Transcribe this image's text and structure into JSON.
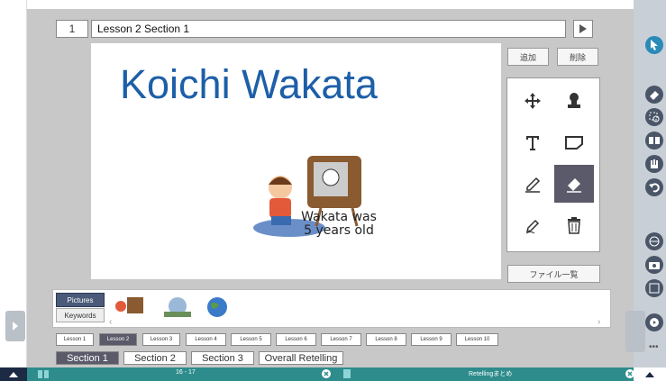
{
  "header": {
    "page_number": "1",
    "title": "Lesson 2 Section 1"
  },
  "slide": {
    "title": "Koichi Wakata",
    "caption_line1": "Wakata was",
    "caption_line2": "5 years old"
  },
  "buttons": {
    "add": "追加",
    "delete": "削除",
    "file_list": "ファイル一覧"
  },
  "tools": [
    "move-icon",
    "stamp-icon",
    "text-icon",
    "shape-icon",
    "pen-icon",
    "eraser-icon",
    "highlighter-icon",
    "trash-icon"
  ],
  "tabs": {
    "pictures": "Pictures",
    "keywords": "Keywords"
  },
  "lessons": [
    "Lesson 1",
    "Lesson 2",
    "Lesson 3",
    "Lesson 4",
    "Lesson 5",
    "Lesson 6",
    "Lesson 7",
    "Lesson 8",
    "Lesson 9",
    "Lesson 10"
  ],
  "sections": [
    "Section 1",
    "Section 2",
    "Section 3",
    "Overall Retelling"
  ],
  "status": {
    "pages": "16 - 17",
    "retelling": "Retellingまとめ"
  },
  "colors": {
    "title_blue": "#1d5fa8",
    "selected": "#5a5a6a",
    "status_teal": "#2e8c8c"
  }
}
